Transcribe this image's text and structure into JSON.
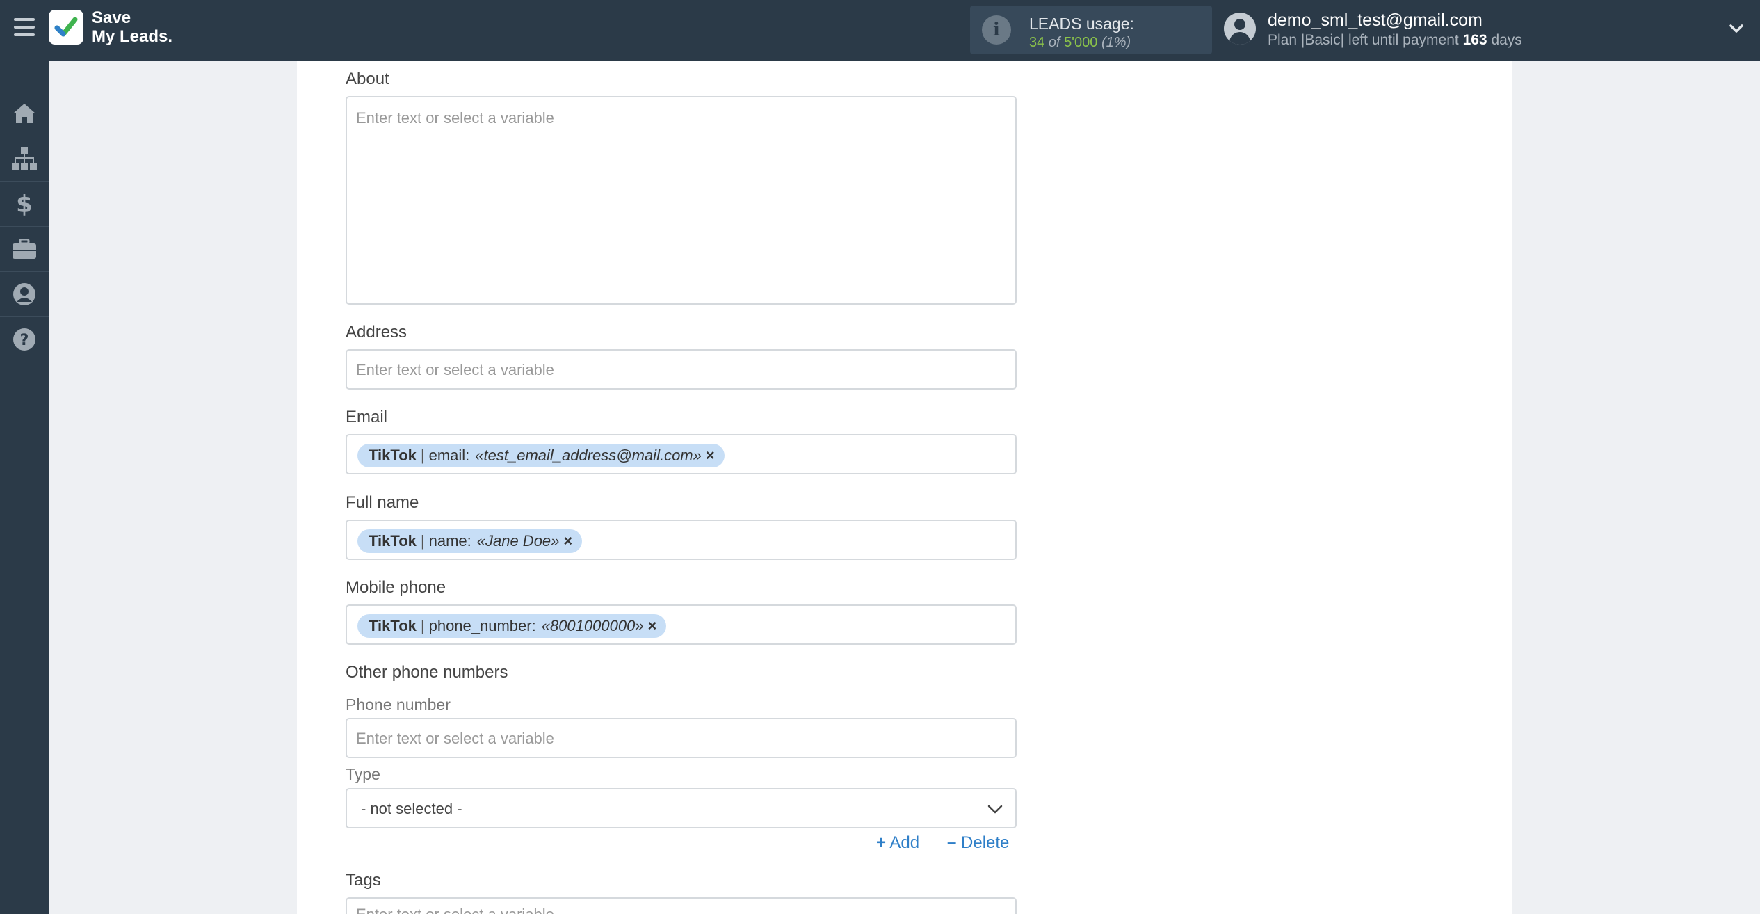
{
  "header": {
    "logo_line1": "Save",
    "logo_line2": "My Leads.",
    "usage_title": "LEADS usage:",
    "usage_used": "34",
    "usage_of": "of",
    "usage_total": "5'000",
    "usage_percent": "(1%)",
    "user_email": "demo_sml_test@gmail.com",
    "plan_text": "Plan |Basic| left until payment",
    "plan_days": "163",
    "plan_days_suffix": "days"
  },
  "sidebar": {
    "items": [
      "home-icon",
      "sitemap-icon",
      "dollar-icon",
      "briefcase-icon",
      "user-circle-icon",
      "question-icon"
    ]
  },
  "form": {
    "about": {
      "label": "About",
      "placeholder": "Enter text or select a variable"
    },
    "address": {
      "label": "Address",
      "placeholder": "Enter text or select a variable"
    },
    "email": {
      "label": "Email",
      "tag": {
        "source": "TikTok",
        "separator": "|",
        "field": "email:",
        "value": "«test_email_address@mail.com»",
        "remove": "×"
      }
    },
    "full_name": {
      "label": "Full name",
      "tag": {
        "source": "TikTok",
        "separator": "|",
        "field": "name:",
        "value": "«Jane Doe»",
        "remove": "×"
      }
    },
    "mobile_phone": {
      "label": "Mobile phone",
      "tag": {
        "source": "TikTok",
        "separator": "|",
        "field": "phone_number:",
        "value": "«8001000000»",
        "remove": "×"
      }
    },
    "other_phones": {
      "title": "Other phone numbers",
      "phone_label": "Phone number",
      "phone_placeholder": "Enter text or select a variable",
      "type_label": "Type",
      "type_value": "- not selected -",
      "add_label": "Add",
      "delete_label": "Delete"
    },
    "tags": {
      "label": "Tags",
      "placeholder": "Enter text or select a variable"
    }
  },
  "colors": {
    "header_bg": "#2b3a48",
    "accent_link": "#2f7fc8",
    "tag_bg": "#c7def6",
    "usage_green": "#8bc34a"
  }
}
